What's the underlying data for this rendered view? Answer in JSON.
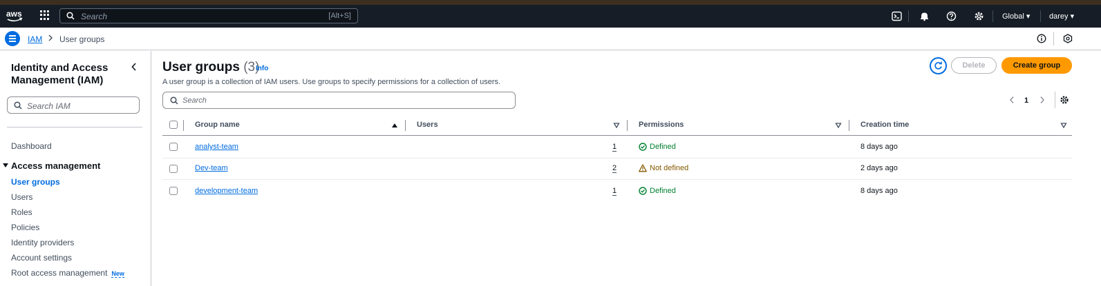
{
  "topbar": {
    "logo_text": "aws",
    "search_placeholder": "Search",
    "search_shortcut": "[Alt+S]",
    "region": "Global",
    "account": "darey"
  },
  "breadcrumb": {
    "root": "IAM",
    "current": "User groups"
  },
  "sidebar": {
    "title": "Identity and Access Management (IAM)",
    "search_placeholder": "Search IAM",
    "dashboard": "Dashboard",
    "section": "Access management",
    "items": [
      {
        "label": "User groups",
        "active": true
      },
      {
        "label": "Users"
      },
      {
        "label": "Roles"
      },
      {
        "label": "Policies"
      },
      {
        "label": "Identity providers"
      },
      {
        "label": "Account settings"
      },
      {
        "label": "Root access management",
        "badge": "New"
      }
    ]
  },
  "main": {
    "title": "User groups",
    "count": "(3)",
    "info": "Info",
    "description": "A user group is a collection of IAM users. Use groups to specify permissions for a collection of users.",
    "delete_label": "Delete",
    "create_label": "Create group",
    "search_placeholder": "Search",
    "page": "1",
    "columns": [
      "Group name",
      "Users",
      "Permissions",
      "Creation time"
    ],
    "rows": [
      {
        "name": "analyst-team",
        "users": "1",
        "permissions": "Defined",
        "perm_status": "ok",
        "created": "8 days ago"
      },
      {
        "name": "Dev-team",
        "users": "2",
        "permissions": "Not defined",
        "perm_status": "warn",
        "created": "2 days ago"
      },
      {
        "name": "development-team",
        "users": "1",
        "permissions": "Defined",
        "perm_status": "ok",
        "created": "8 days ago"
      }
    ]
  },
  "colors": {
    "accent": "#006ce0",
    "primary_button": "#ff9900",
    "success": "#00802f",
    "warning": "#855900",
    "topbar": "#161d26"
  },
  "icons": [
    "aws-logo",
    "apps-grid-icon",
    "search-icon",
    "cloudshell-icon",
    "bell-icon",
    "help-icon",
    "gear-icon",
    "menu-icon",
    "chevron-right-icon",
    "info-icon",
    "security-icon",
    "chevron-left-icon",
    "refresh-icon",
    "sort-asc-icon",
    "sort-desc-icon",
    "check-circle-icon",
    "warning-icon"
  ]
}
